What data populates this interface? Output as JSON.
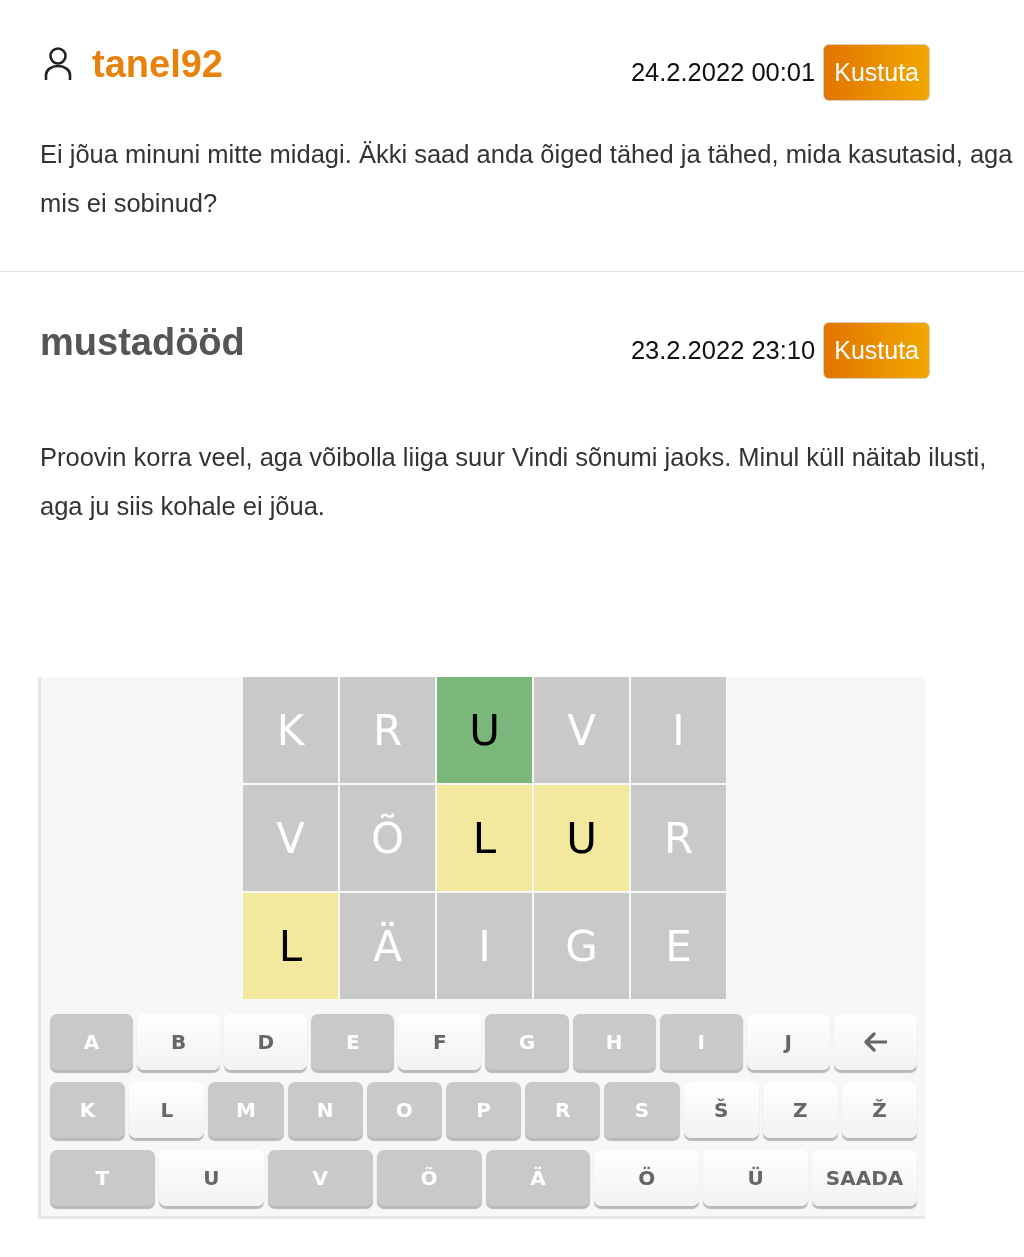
{
  "comments": [
    {
      "kind": "registered",
      "author": "tanel92",
      "date": "24.2.2022 00:01",
      "delete_button": "Kustuta",
      "text": "Ei jõua minuni mitte midagi. Äkki saad anda õiged tähed ja tähed, mida kasutasid, aga mis ei sobinud?"
    },
    {
      "kind": "guest",
      "author": "mustadööd",
      "date": "23.2.2022 23:10",
      "delete_button": "Kustuta",
      "text": "Proovin korra veel, aga võibolla liiga suur Vindi sõnumi jaoks. Minul küll näitab ilusti, aga ju siis kohale ei jõua.",
      "attachment": {
        "grid": [
          [
            {
              "letter": "K",
              "kind": "absent"
            },
            {
              "letter": "R",
              "kind": "absent"
            },
            {
              "letter": "U",
              "kind": "correct"
            },
            {
              "letter": "V",
              "kind": "absent"
            },
            {
              "letter": "I",
              "kind": "absent"
            }
          ],
          [
            {
              "letter": "V",
              "kind": "absent"
            },
            {
              "letter": "Õ",
              "kind": "absent"
            },
            {
              "letter": "L",
              "kind": "present"
            },
            {
              "letter": "U",
              "kind": "present"
            },
            {
              "letter": "R",
              "kind": "absent"
            }
          ],
          [
            {
              "letter": "L",
              "kind": "present"
            },
            {
              "letter": "Ä",
              "kind": "absent"
            },
            {
              "letter": "I",
              "kind": "absent"
            },
            {
              "letter": "G",
              "kind": "absent"
            },
            {
              "letter": "E",
              "kind": "absent"
            }
          ]
        ],
        "keyboard": [
          [
            {
              "kind": "letter",
              "label": "A",
              "eliminated": true
            },
            {
              "kind": "letter",
              "label": "B",
              "eliminated": false
            },
            {
              "kind": "letter",
              "label": "D",
              "eliminated": false
            },
            {
              "kind": "letter",
              "label": "E",
              "eliminated": true
            },
            {
              "kind": "letter",
              "label": "F",
              "eliminated": false
            },
            {
              "kind": "letter",
              "label": "G",
              "eliminated": true
            },
            {
              "kind": "letter",
              "label": "H",
              "eliminated": true
            },
            {
              "kind": "letter",
              "label": "I",
              "eliminated": true
            },
            {
              "kind": "letter",
              "label": "J",
              "eliminated": false
            },
            {
              "kind": "backspace",
              "eliminated": false
            }
          ],
          [
            {
              "kind": "letter",
              "label": "K",
              "eliminated": true
            },
            {
              "kind": "letter",
              "label": "L",
              "eliminated": false
            },
            {
              "kind": "letter",
              "label": "M",
              "eliminated": true
            },
            {
              "kind": "letter",
              "label": "N",
              "eliminated": true
            },
            {
              "kind": "letter",
              "label": "O",
              "eliminated": true
            },
            {
              "kind": "letter",
              "label": "P",
              "eliminated": true
            },
            {
              "kind": "letter",
              "label": "R",
              "eliminated": true
            },
            {
              "kind": "letter",
              "label": "S",
              "eliminated": true
            },
            {
              "kind": "letter",
              "label": "Š",
              "eliminated": false
            },
            {
              "kind": "letter",
              "label": "Z",
              "eliminated": false
            },
            {
              "kind": "letter",
              "label": "Ž",
              "eliminated": false
            }
          ],
          [
            {
              "kind": "letter",
              "label": "T",
              "eliminated": true
            },
            {
              "kind": "letter",
              "label": "U",
              "eliminated": false
            },
            {
              "kind": "letter",
              "label": "V",
              "eliminated": true
            },
            {
              "kind": "letter",
              "label": "Õ",
              "eliminated": true
            },
            {
              "kind": "letter",
              "label": "Ä",
              "eliminated": true
            },
            {
              "kind": "letter",
              "label": "Ö",
              "eliminated": false
            },
            {
              "kind": "letter",
              "label": "Ü",
              "eliminated": false
            },
            {
              "kind": "submit",
              "label": "SAADA",
              "eliminated": false
            }
          ]
        ]
      }
    }
  ]
}
